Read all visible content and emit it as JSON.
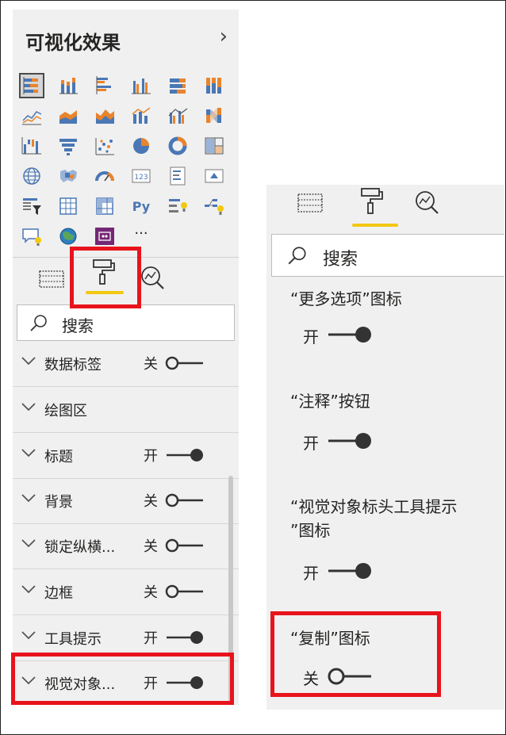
{
  "left_panel": {
    "title": "可视化效果",
    "search_placeholder": "搜索",
    "visual_icons": [
      "stacked-bar-chart-icon",
      "stacked-column-chart-icon",
      "clustered-bar-chart-icon",
      "clustered-column-chart-icon",
      "100-stacked-bar-chart-icon",
      "100-stacked-column-chart-icon",
      "line-chart-icon",
      "area-chart-icon",
      "stacked-area-chart-icon",
      "line-stacked-column-chart-icon",
      "line-clustered-column-chart-icon",
      "ribbon-chart-icon",
      "waterfall-chart-icon",
      "funnel-chart-icon",
      "scatter-chart-icon",
      "pie-chart-icon",
      "donut-chart-icon",
      "treemap-icon",
      "map-icon",
      "filled-map-icon",
      "gauge-icon",
      "card-icon",
      "multi-row-card-icon",
      "kpi-icon",
      "slicer-icon",
      "table-icon",
      "matrix-icon",
      "python-visual-icon",
      "key-influencers-icon",
      "decomposition-tree-icon",
      "qa-icon",
      "arcgis-map-icon",
      "power-apps-icon",
      "more-visuals-icon"
    ],
    "python_label": "Py",
    "card_label": "123",
    "more_label": "···",
    "sections": [
      {
        "label": "数据标签",
        "state": "关",
        "on": false
      },
      {
        "label": "绘图区",
        "state": "",
        "on": null
      },
      {
        "label": "标题",
        "state": "开",
        "on": true
      },
      {
        "label": "背景",
        "state": "关",
        "on": false
      },
      {
        "label": "锁定纵横...",
        "state": "关",
        "on": false
      },
      {
        "label": "边框",
        "state": "关",
        "on": false
      },
      {
        "label": "工具提示",
        "state": "开",
        "on": true
      },
      {
        "label": "视觉对象...",
        "state": "开",
        "on": true
      }
    ]
  },
  "right_panel": {
    "search_placeholder": "搜索",
    "options": [
      {
        "label": "“更多选项”图标",
        "state": "开",
        "on": true
      },
      {
        "label": "“注释”按钮",
        "state": "开",
        "on": true
      },
      {
        "label_line1": "“视觉对象标头工具提示",
        "label_line2": "”图标",
        "state": "开",
        "on": true
      },
      {
        "label": "“复制”图标",
        "state": "关",
        "on": false
      }
    ]
  },
  "colors": {
    "accent_yellow": "#f2c811",
    "highlight_red": "#e8141c",
    "panel_bg": "#f0f0f0",
    "chart_blue": "#4a77b5",
    "chart_orange": "#e8842c"
  }
}
